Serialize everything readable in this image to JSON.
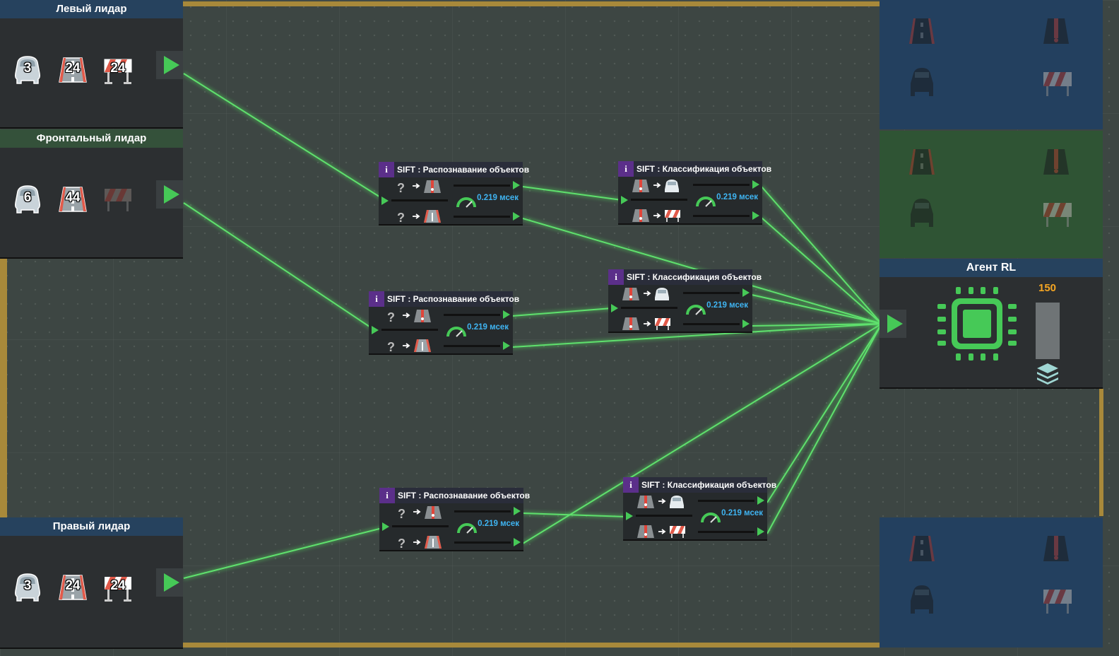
{
  "sensors": {
    "left": {
      "title": "Левый лидар",
      "cars": "3",
      "roads": "24",
      "barriers": "24"
    },
    "front": {
      "title": "Фронтальный лидар",
      "cars": "6",
      "roads": "44",
      "barriers": ""
    },
    "right": {
      "title": "Правый лидар",
      "cars": "3",
      "roads": "24",
      "barriers": "24"
    }
  },
  "nodes": {
    "recognition_title": "SIFT : Распознавание объектов",
    "classification_title": "SIFT : Классификация объектов",
    "speed": "0.219 мсек",
    "info": "i",
    "unknown_symbol": "?",
    "arrow_symbol": "➔"
  },
  "agent": {
    "title": "Агент RL",
    "count": "150",
    "bar_level": 1.0
  },
  "colors": {
    "wire": "#4ccf5c",
    "accent_green": "#46c957",
    "speed_text": "#3fb4f2",
    "count_text": "#f5a623",
    "panel_blue": "#23405f",
    "panel_green": "#2f5434",
    "rail": "#a8893a",
    "node_info": "#5b2f8a"
  },
  "icons": [
    "car-icon",
    "road-icon",
    "barrier-icon",
    "road-alert-icon",
    "play-icon",
    "question-icon",
    "gauge-icon",
    "chip-icon",
    "layers-icon",
    "info-icon"
  ]
}
